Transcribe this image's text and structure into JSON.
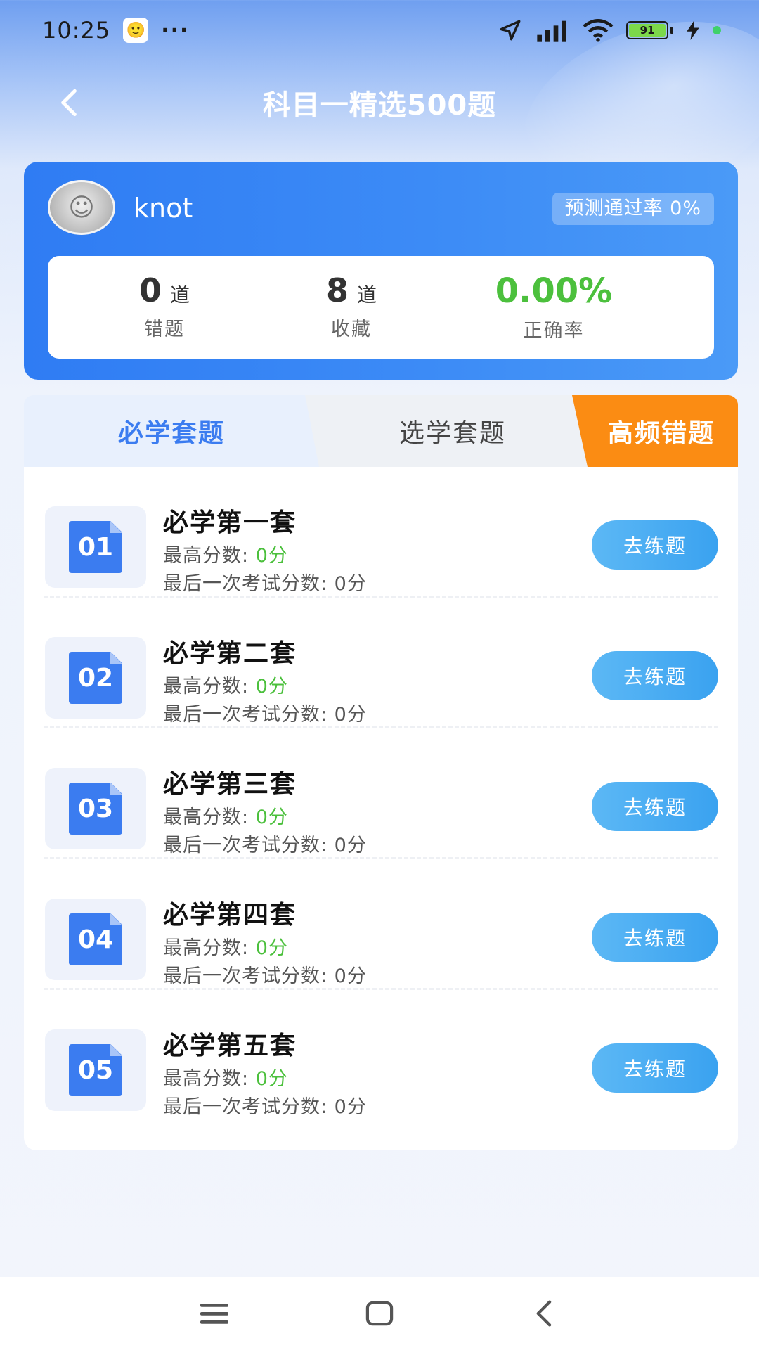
{
  "status_bar": {
    "time": "10:25",
    "more": "···",
    "battery": "91"
  },
  "header": {
    "title": "科目一精选500题"
  },
  "profile": {
    "username": "knot",
    "pass_rate": "预测通过率 0%",
    "stats": {
      "wrong": {
        "value": "0",
        "unit": "道",
        "label": "错题"
      },
      "saved": {
        "value": "8",
        "unit": "道",
        "label": "收藏"
      },
      "accuracy": {
        "value": "0.00%",
        "label": "正确率"
      }
    }
  },
  "tabs": [
    {
      "label": "必学套题"
    },
    {
      "label": "选学套题"
    },
    {
      "label": "高频错题"
    }
  ],
  "sets": [
    {
      "num": "01",
      "title": "必学第一套",
      "best_label": "最高分数: ",
      "best_value": "0分",
      "last": "最后一次考试分数: 0分",
      "button": "去练题"
    },
    {
      "num": "02",
      "title": "必学第二套",
      "best_label": "最高分数: ",
      "best_value": "0分",
      "last": "最后一次考试分数: 0分",
      "button": "去练题"
    },
    {
      "num": "03",
      "title": "必学第三套",
      "best_label": "最高分数: ",
      "best_value": "0分",
      "last": "最后一次考试分数: 0分",
      "button": "去练题"
    },
    {
      "num": "04",
      "title": "必学第四套",
      "best_label": "最高分数: ",
      "best_value": "0分",
      "last": "最后一次考试分数: 0分",
      "button": "去练题"
    },
    {
      "num": "05",
      "title": "必学第五套",
      "best_label": "最高分数: ",
      "best_value": "0分",
      "last": "最后一次考试分数: 0分",
      "button": "去练题"
    }
  ],
  "colors": {
    "primary_blue": "#2f7cf3",
    "accent_orange": "#fb8c13",
    "success_green": "#4cc03d",
    "button_blue": "#3aa2f0"
  }
}
